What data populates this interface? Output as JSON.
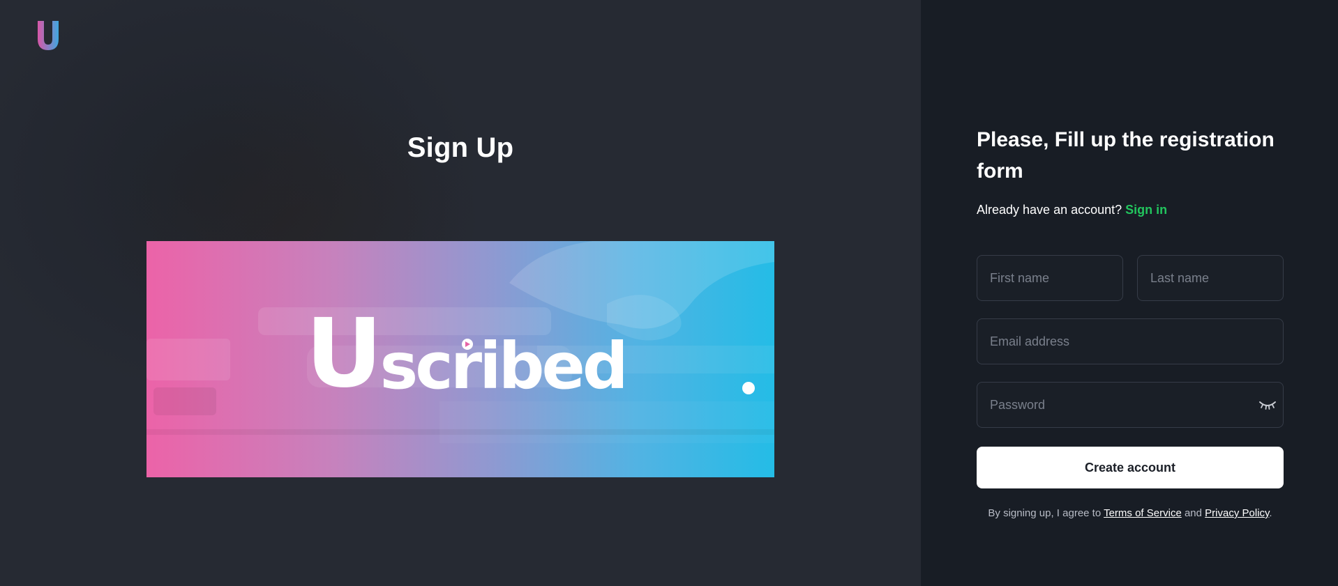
{
  "brand": {
    "logo_letter": "U",
    "logo_colors": [
      "#d857a8",
      "#3fa7e0"
    ]
  },
  "left": {
    "title": "Sign Up",
    "banner": {
      "wordmark_initial": "U",
      "wordmark_rest": "scribed",
      "gradient_colors": [
        "#ec63a8",
        "#24bce6"
      ]
    }
  },
  "form": {
    "title": "Please, Fill up the registration form",
    "have_account_text": "Already have an account?",
    "signin_label": "Sign in",
    "first_name_placeholder": "First name",
    "last_name_placeholder": "Last name",
    "email_placeholder": "Email address",
    "password_placeholder": "Password",
    "password_toggle_icon": "eye-closed-icon",
    "submit_label": "Create account",
    "terms_prefix": "By signing up, I agree to",
    "terms_link": "Terms of Service",
    "terms_and": "and",
    "privacy_link": "Privacy Policy",
    "terms_suffix": "."
  },
  "colors": {
    "accent": "#22c55e",
    "left_bg": "#262a33",
    "right_bg": "#181d25",
    "button_bg": "#ffffff"
  }
}
